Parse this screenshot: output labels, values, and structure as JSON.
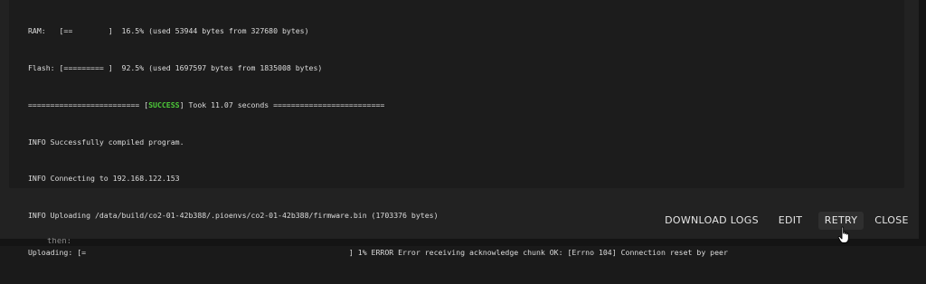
{
  "log": {
    "lines": [
      "RAM:   [==        ]  16.5% (used 53944 bytes from 327680 bytes)",
      "Flash: [========= ]  92.5% (used 1697597 bytes from 1835008 bytes)",
      "INFO Successfully compiled program.",
      "INFO Connecting to 192.168.122.153",
      "INFO Uploading /data/build/co2-01-42b388/.pioenvs/co2-01-42b388/firmware.bin (1703376 bytes)",
      "Uploading: [=                                                           ] 1% ERROR Error receiving acknowledge chunk OK: [Errno 104] Connection reset by peer"
    ],
    "success_line": {
      "prefix": "========================= [",
      "status": "SUCCESS",
      "suffix": "] Took 11.07 seconds ========================="
    },
    "success_color": "#4ecb3a"
  },
  "actions": {
    "download_logs": "DOWNLOAD LOGS",
    "edit": "EDIT",
    "retry": "RETRY",
    "close": "CLOSE"
  },
  "background_code": {
    "partial_text": "then:"
  },
  "cursor": {
    "icon": "hand-pointer-icon"
  }
}
